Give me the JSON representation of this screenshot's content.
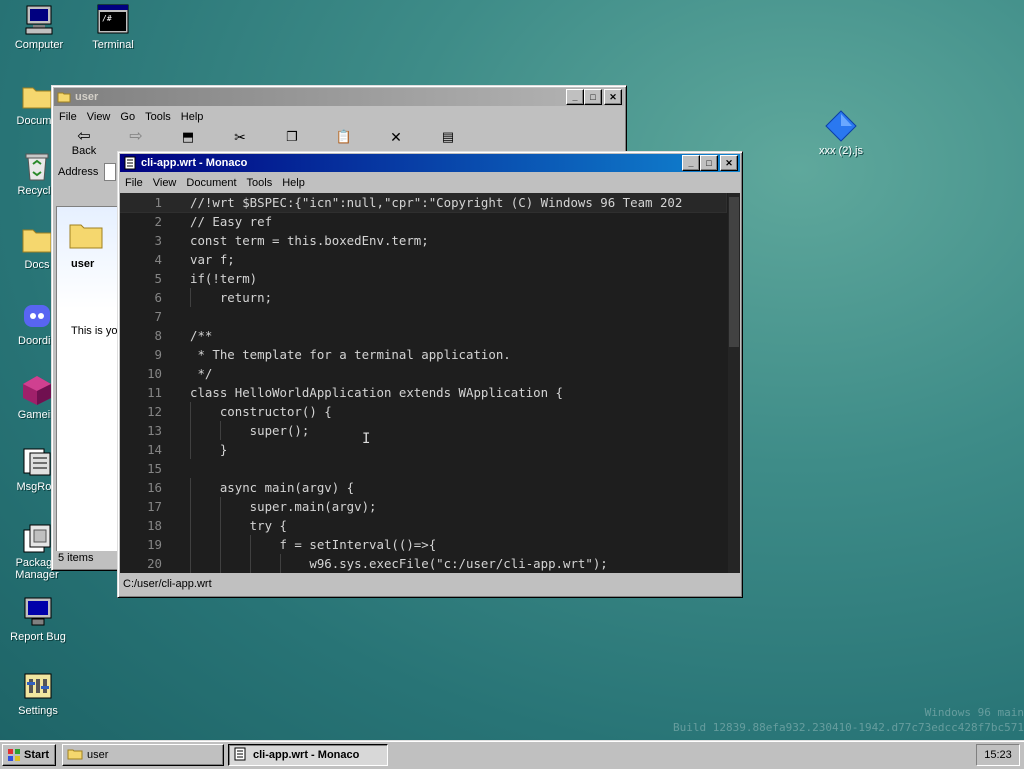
{
  "desktop": {
    "icons": [
      {
        "label": "Computer",
        "icon": "computer-icon"
      },
      {
        "label": "Terminal",
        "icon": "terminal-icon"
      },
      {
        "label": "Docume",
        "icon": "folder-icon"
      },
      {
        "label": "Recycle",
        "icon": "recycle-bin-icon"
      },
      {
        "label": "Docs",
        "icon": "folder-icon"
      },
      {
        "label": "Doordis",
        "icon": "discord-icon"
      },
      {
        "label": "Gamein",
        "icon": "cube-icon"
      },
      {
        "label": "MsgRoo",
        "icon": "msgroom-icon"
      },
      {
        "label": "Package Manager",
        "icon": "package-icon"
      },
      {
        "label": "Report Bug",
        "icon": "monitor-bug-icon"
      },
      {
        "label": "Settings",
        "icon": "settings-icon"
      },
      {
        "label": "xxx (2).js",
        "icon": "js-file-icon"
      }
    ],
    "watermark": [
      "Windows 96 main",
      "Build 12839.88efa932.230410-1942.d77c73edcc428f7bc571"
    ]
  },
  "explorer": {
    "title": "user",
    "menu": [
      "File",
      "View",
      "Go",
      "Tools",
      "Help"
    ],
    "toolbar": [
      {
        "label": "Back",
        "icon": "back-arrow-icon"
      }
    ],
    "address_label": "Address",
    "folder_name": "user",
    "desc_text": "This is you",
    "status": "5 items"
  },
  "editor": {
    "title": "cli-app.wrt - Monaco",
    "menu": [
      "File",
      "View",
      "Document",
      "Tools",
      "Help"
    ],
    "status_path": "C:/user/cli-app.wrt",
    "lines": [
      {
        "n": "1",
        "code": "//!wrt $BSPEC:{\"icn\":null,\"cpr\":\"Copyright (C) Windows 96 Team 202"
      },
      {
        "n": "2",
        "code": "// Easy ref"
      },
      {
        "n": "3",
        "code": "const term = this.boxedEnv.term;"
      },
      {
        "n": "4",
        "code": "var f;"
      },
      {
        "n": "5",
        "code": "if(!term)"
      },
      {
        "n": "6",
        "code": "    return;"
      },
      {
        "n": "7",
        "code": ""
      },
      {
        "n": "8",
        "code": "/**"
      },
      {
        "n": "9",
        "code": " * The template for a terminal application."
      },
      {
        "n": "10",
        "code": " */"
      },
      {
        "n": "11",
        "code": "class HelloWorldApplication extends WApplication {"
      },
      {
        "n": "12",
        "code": "    constructor() {"
      },
      {
        "n": "13",
        "code": "        super();"
      },
      {
        "n": "14",
        "code": "    }"
      },
      {
        "n": "15",
        "code": ""
      },
      {
        "n": "16",
        "code": "    async main(argv) {"
      },
      {
        "n": "17",
        "code": "        super.main(argv);"
      },
      {
        "n": "18",
        "code": "        try {"
      },
      {
        "n": "19",
        "code": "            f = setInterval(()=>{"
      },
      {
        "n": "20",
        "code": "                w96.sys.execFile(\"c:/user/cli-app.wrt\");"
      }
    ]
  },
  "taskbar": {
    "start_label": "Start",
    "tasks": [
      {
        "label": "user",
        "active": false
      },
      {
        "label": "cli-app.wrt - Monaco",
        "active": true
      }
    ],
    "clock": "15:23"
  }
}
